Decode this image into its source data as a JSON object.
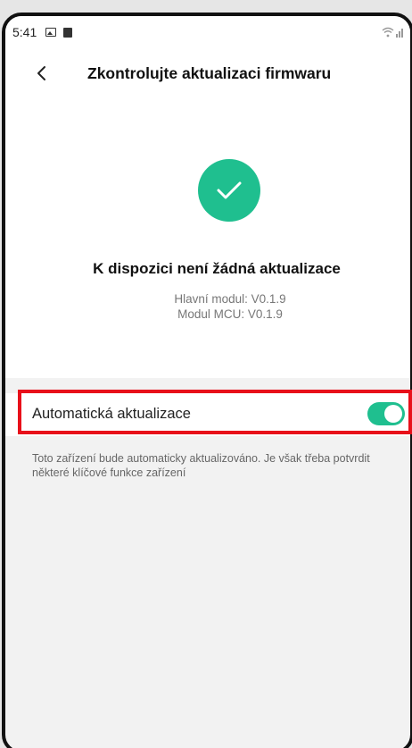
{
  "statusbar": {
    "time": "5:41"
  },
  "header": {
    "title": "Zkontrolujte aktualizaci firmwaru"
  },
  "status": {
    "title": "K dispozici není žádná aktualizace",
    "main_module": "Hlavní modul: V0.1.9",
    "mcu_module": "Modul MCU: V0.1.9"
  },
  "auto_update": {
    "label": "Automatická aktualizace",
    "enabled": true,
    "description": "Toto zařízení bude automaticky aktualizováno. Je však třeba potvrdit některé klíčové funkce zařízení"
  },
  "colors": {
    "accent": "#1fbf8f",
    "highlight": "#e8101a"
  },
  "icons": {
    "back": "chevron-left-icon",
    "success": "check-icon"
  }
}
